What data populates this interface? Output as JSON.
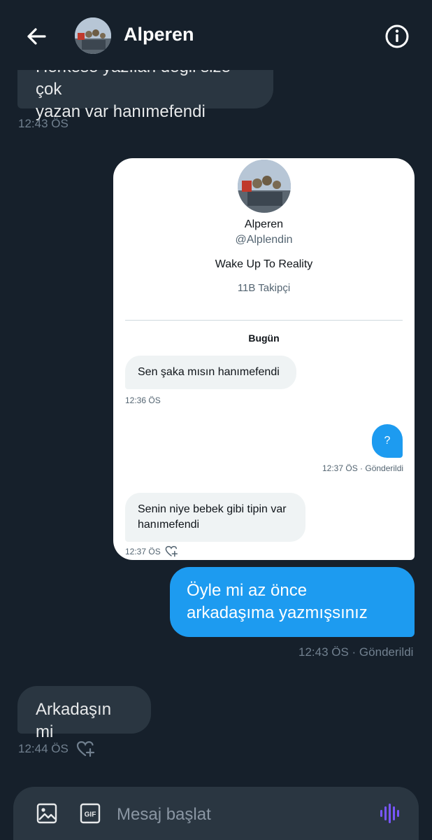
{
  "header": {
    "name": "Alperen"
  },
  "messages": {
    "first_incoming": {
      "text_clipped": "Herkese yazılan değil size çok",
      "text_line2": "yazan var hanımefendi",
      "time": "12:43 ÖS"
    },
    "outgoing_reply": {
      "text": "Öyle mi az önce arkadaşıma yazmışsınız",
      "meta": "12:43 ÖS · Gönderildi"
    },
    "last_incoming": {
      "text": "Arkadaşın mi",
      "time": "12:44 ÖS"
    }
  },
  "card": {
    "name": "Alperen",
    "handle": "@Alplendin",
    "bio": "Wake Up To Reality",
    "followers": "11B Takipçi",
    "day": "Bugün",
    "msg1": {
      "text": "Sen şaka mısın hanımefendi",
      "time": "12:36 ÖS"
    },
    "msg2": {
      "text": "?",
      "meta": "12:37 ÖS · Gönderildi"
    },
    "msg3": {
      "text": "Senin niye bebek gibi tipin var hanımefendi",
      "time": "12:37 ÖS"
    }
  },
  "composer": {
    "placeholder": "Mesaj başlat",
    "icons": [
      "image-icon",
      "gif-icon",
      "voice-icon"
    ]
  },
  "colors": {
    "background": "#16202b",
    "incoming_bubble": "#2a3641",
    "outgoing_bubble": "#1d9bf0",
    "voice_accent": "#7856ff"
  }
}
